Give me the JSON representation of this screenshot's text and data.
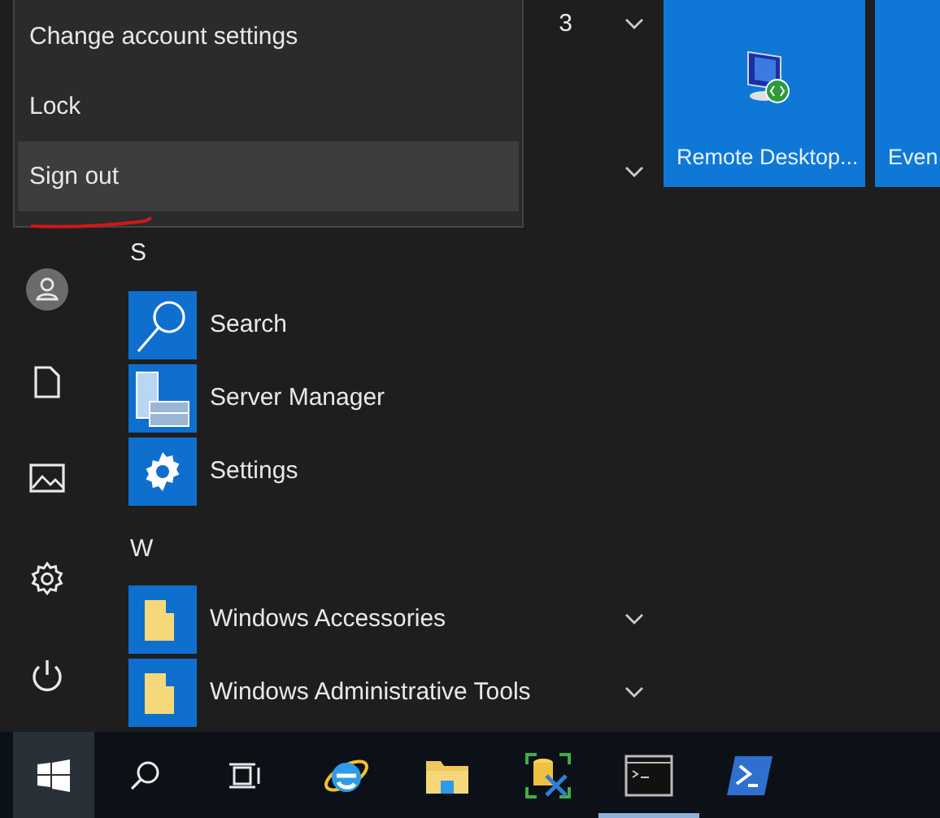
{
  "account_menu": {
    "items": [
      {
        "label": "Change account settings",
        "selected": false,
        "underlined": false
      },
      {
        "label": "Lock",
        "selected": false,
        "underlined": false
      },
      {
        "label": "Sign out",
        "selected": true,
        "underlined": true
      }
    ]
  },
  "app_list": [
    {
      "kind": "group",
      "label": "3"
    },
    {
      "kind": "group"
    },
    {
      "kind": "header",
      "label": "S"
    },
    {
      "kind": "app",
      "label": "Search"
    },
    {
      "kind": "app",
      "label": "Server Manager"
    },
    {
      "kind": "app",
      "label": "Settings"
    },
    {
      "kind": "header",
      "label": "W"
    },
    {
      "kind": "group",
      "label": "Windows Accessories"
    },
    {
      "kind": "group",
      "label": "Windows Administrative Tools"
    }
  ],
  "tiles": [
    {
      "label": "Remote Desktop..."
    },
    {
      "label": "Even"
    }
  ],
  "taskbar": {
    "start": {
      "selected": true
    },
    "items": [
      {
        "active": false
      },
      {
        "active": false
      },
      {
        "active": false
      },
      {
        "active": false
      },
      {
        "active": false
      },
      {
        "active": true
      },
      {
        "active": false
      }
    ]
  }
}
